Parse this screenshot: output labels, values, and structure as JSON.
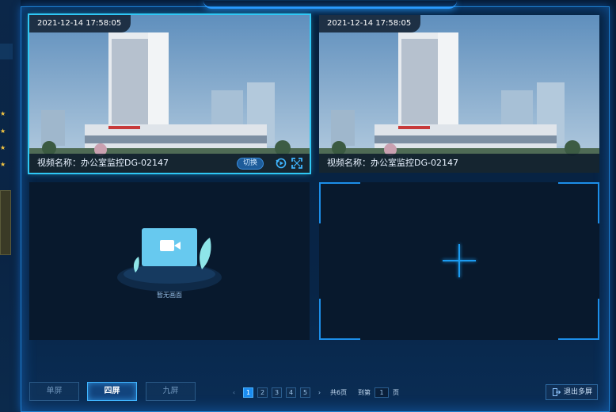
{
  "cells": [
    {
      "timestamp": "2021-12-14 17:58:05",
      "video_name": "视频名称：办公室监控DG-02147",
      "switch_label": "切换",
      "active": true
    },
    {
      "timestamp": "2021-12-14 17:58:05",
      "video_name": "视频名称：办公室监控DG-02147",
      "active": false
    }
  ],
  "empty_cell": {
    "label": "暂无画面"
  },
  "layout_buttons": [
    {
      "label": "单屏",
      "selected": false
    },
    {
      "label": "四屏",
      "selected": true
    },
    {
      "label": "九屏",
      "selected": false
    }
  ],
  "pagination": {
    "pages": [
      "1",
      "2",
      "3",
      "4",
      "5"
    ],
    "current": "1",
    "total_text": "共6页",
    "goto_label": "到第",
    "goto_value": "1",
    "goto_suffix": "页"
  },
  "exit_button": {
    "label": "退出多屏"
  },
  "colors": {
    "accent": "#1b8cf0",
    "active_border": "#2fc8f5",
    "panel": "#08192d"
  }
}
